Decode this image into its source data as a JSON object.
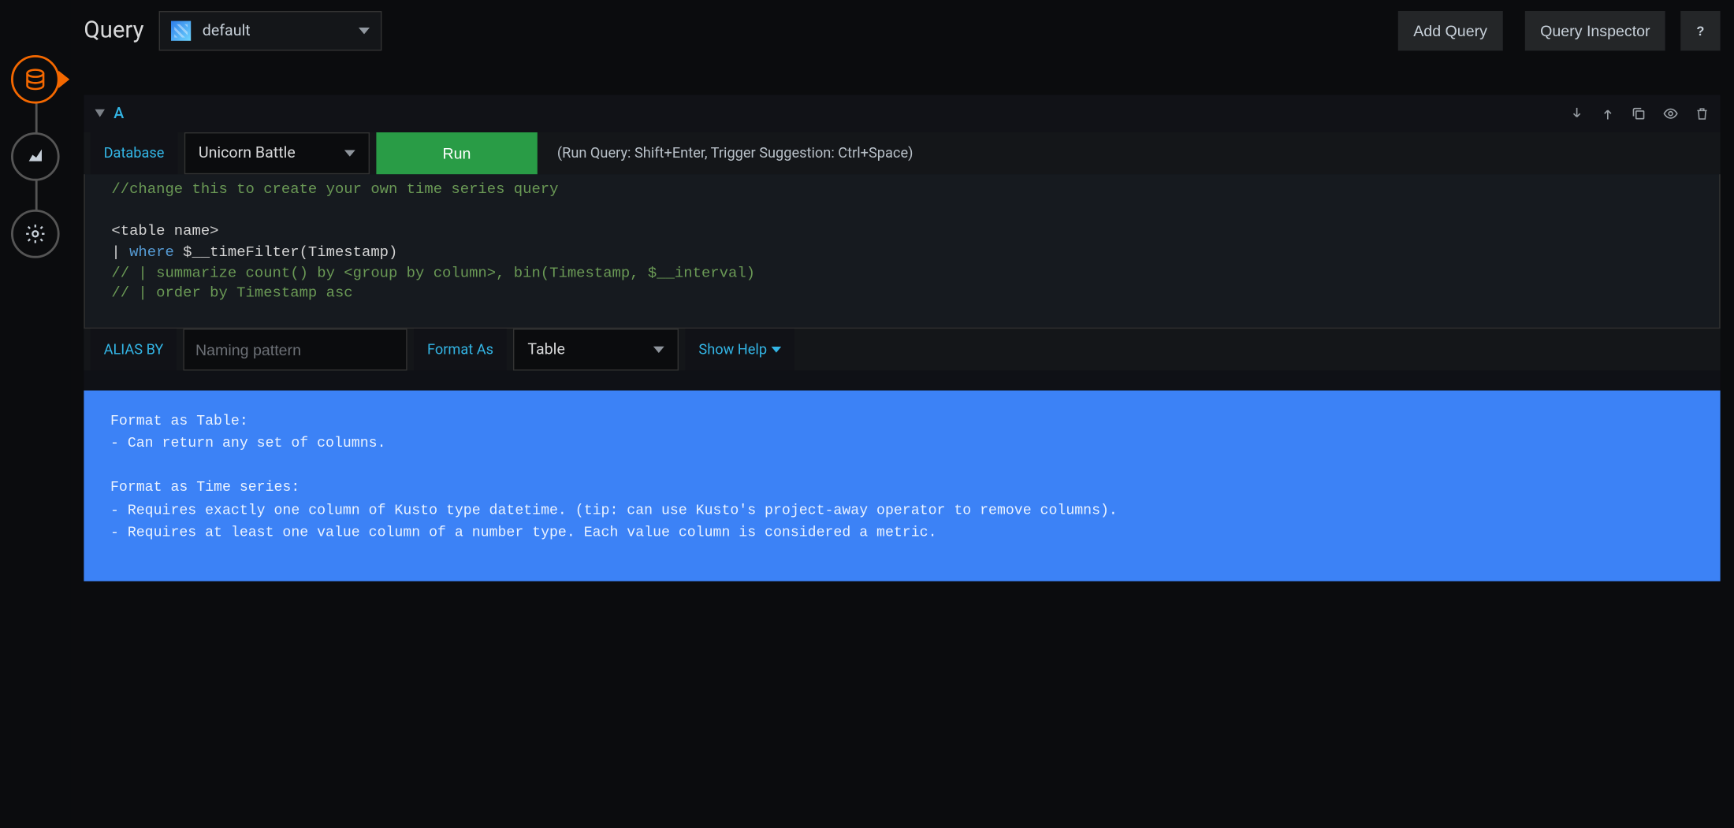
{
  "header": {
    "title": "Query",
    "datasource": "default",
    "add_query": "Add Query",
    "inspector": "Query Inspector"
  },
  "query": {
    "letter": "A",
    "database_label": "Database",
    "database_value": "Unicorn Battle",
    "run_label": "Run",
    "run_hint": "(Run Query: Shift+Enter, Trigger Suggestion: Ctrl+Space)",
    "code": {
      "l1": "//change this to create your own time series query",
      "l2": "<table name>",
      "l3a": "| ",
      "l3b": "where",
      "l3c": " $__timeFilter(Timestamp)",
      "l4": "// | summarize count() by <group by column>, bin(Timestamp, $__interval)",
      "l5": "// | order by Timestamp asc"
    },
    "alias_label": "ALIAS BY",
    "alias_placeholder": "Naming pattern",
    "format_label": "Format As",
    "format_value": "Table",
    "show_help": "Show Help"
  },
  "help_text": "Format as Table:\n- Can return any set of columns.\n\nFormat as Time series:\n- Requires exactly one column of Kusto type datetime. (tip: can use Kusto's project-away operator to remove columns).\n- Requires at least one value column of a number type. Each value column is considered a metric."
}
